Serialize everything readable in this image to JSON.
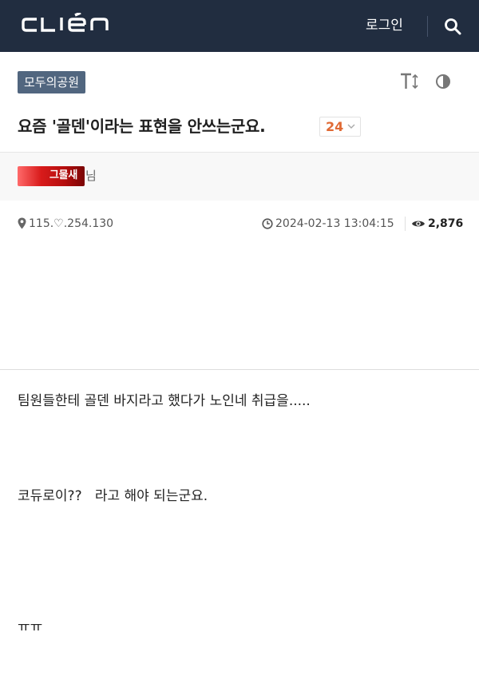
{
  "header": {
    "login_label": "로그인",
    "brand_color": "#212d40"
  },
  "post": {
    "board_badge": "모두의공원",
    "title": "요즘 '골덴'이라는 표현을 안쓰는군요.",
    "comment_count": "24",
    "author_nick": "그물새",
    "author_suffix": "님",
    "ip": "115.♡.254.130",
    "date": "2024-02-13 13:04:15",
    "views": "2,876",
    "body": [
      "팀원들한테 골덴 바지라고 했다가 노인네 취급을.....",
      "코듀로이??   라고 해야 되는군요.",
      "ㅠㅠ"
    ]
  }
}
